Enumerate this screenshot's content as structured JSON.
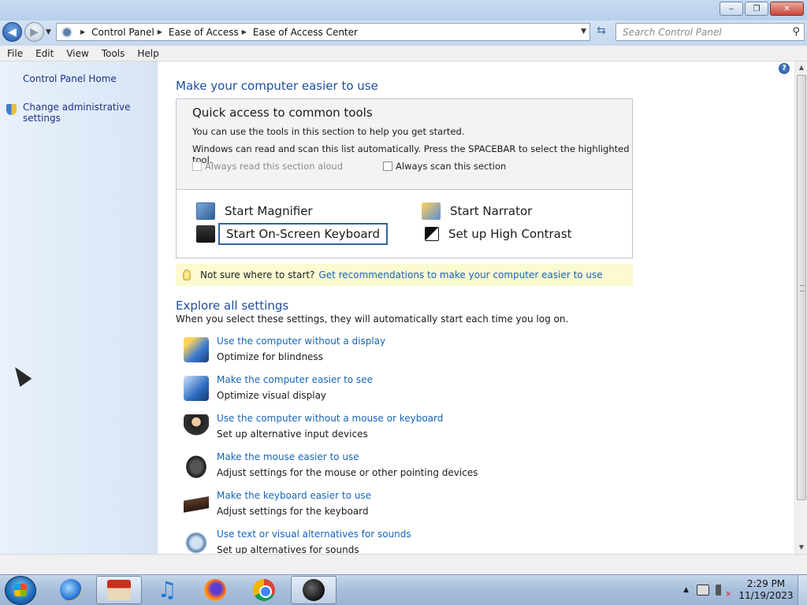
{
  "window": {
    "minimize": "‒",
    "restore": "❐",
    "close": "✕"
  },
  "address": {
    "breadcrumbs": [
      "Control Panel",
      "Ease of Access",
      "Ease of Access Center"
    ],
    "search_placeholder": "Search Control Panel"
  },
  "menu": [
    "File",
    "Edit",
    "View",
    "Tools",
    "Help"
  ],
  "sidebar": {
    "home": "Control Panel Home",
    "admin": "Change administrative settings"
  },
  "main": {
    "title": "Make your computer easier to use",
    "quick": {
      "title": "Quick access to common tools",
      "line1": "You can use the tools in this section to help you get started.",
      "line2": "Windows can read and scan this list automatically.  Press the SPACEBAR to select the highlighted tool.",
      "read_aloud": "Always read this section aloud",
      "scan": "Always scan this section",
      "tools": {
        "magnifier": "Start Magnifier",
        "narrator": "Start Narrator",
        "keyboard": "Start On-Screen Keyboard",
        "contrast": "Set up High Contrast"
      }
    },
    "tip": {
      "prefix": "Not sure where to start?",
      "link": "Get recommendations to make your computer easier to use"
    },
    "explore": {
      "title": "Explore all settings",
      "subtitle": "When you select these settings, they will automatically start each time you log on.",
      "items": [
        {
          "link": "Use the computer without a display",
          "desc": "Optimize for blindness"
        },
        {
          "link": "Make the computer easier to see",
          "desc": "Optimize visual display"
        },
        {
          "link": "Use the computer without a mouse or keyboard",
          "desc": "Set up alternative input devices"
        },
        {
          "link": "Make the mouse easier to use",
          "desc": "Adjust settings for the mouse or other pointing devices"
        },
        {
          "link": "Make the keyboard easier to use",
          "desc": "Adjust settings for the keyboard"
        },
        {
          "link": "Use text or visual alternatives for sounds",
          "desc": "Set up alternatives for sounds"
        }
      ]
    },
    "help": "?"
  },
  "taskbar": {
    "time": "2:29 PM",
    "date": "11/19/2023"
  }
}
